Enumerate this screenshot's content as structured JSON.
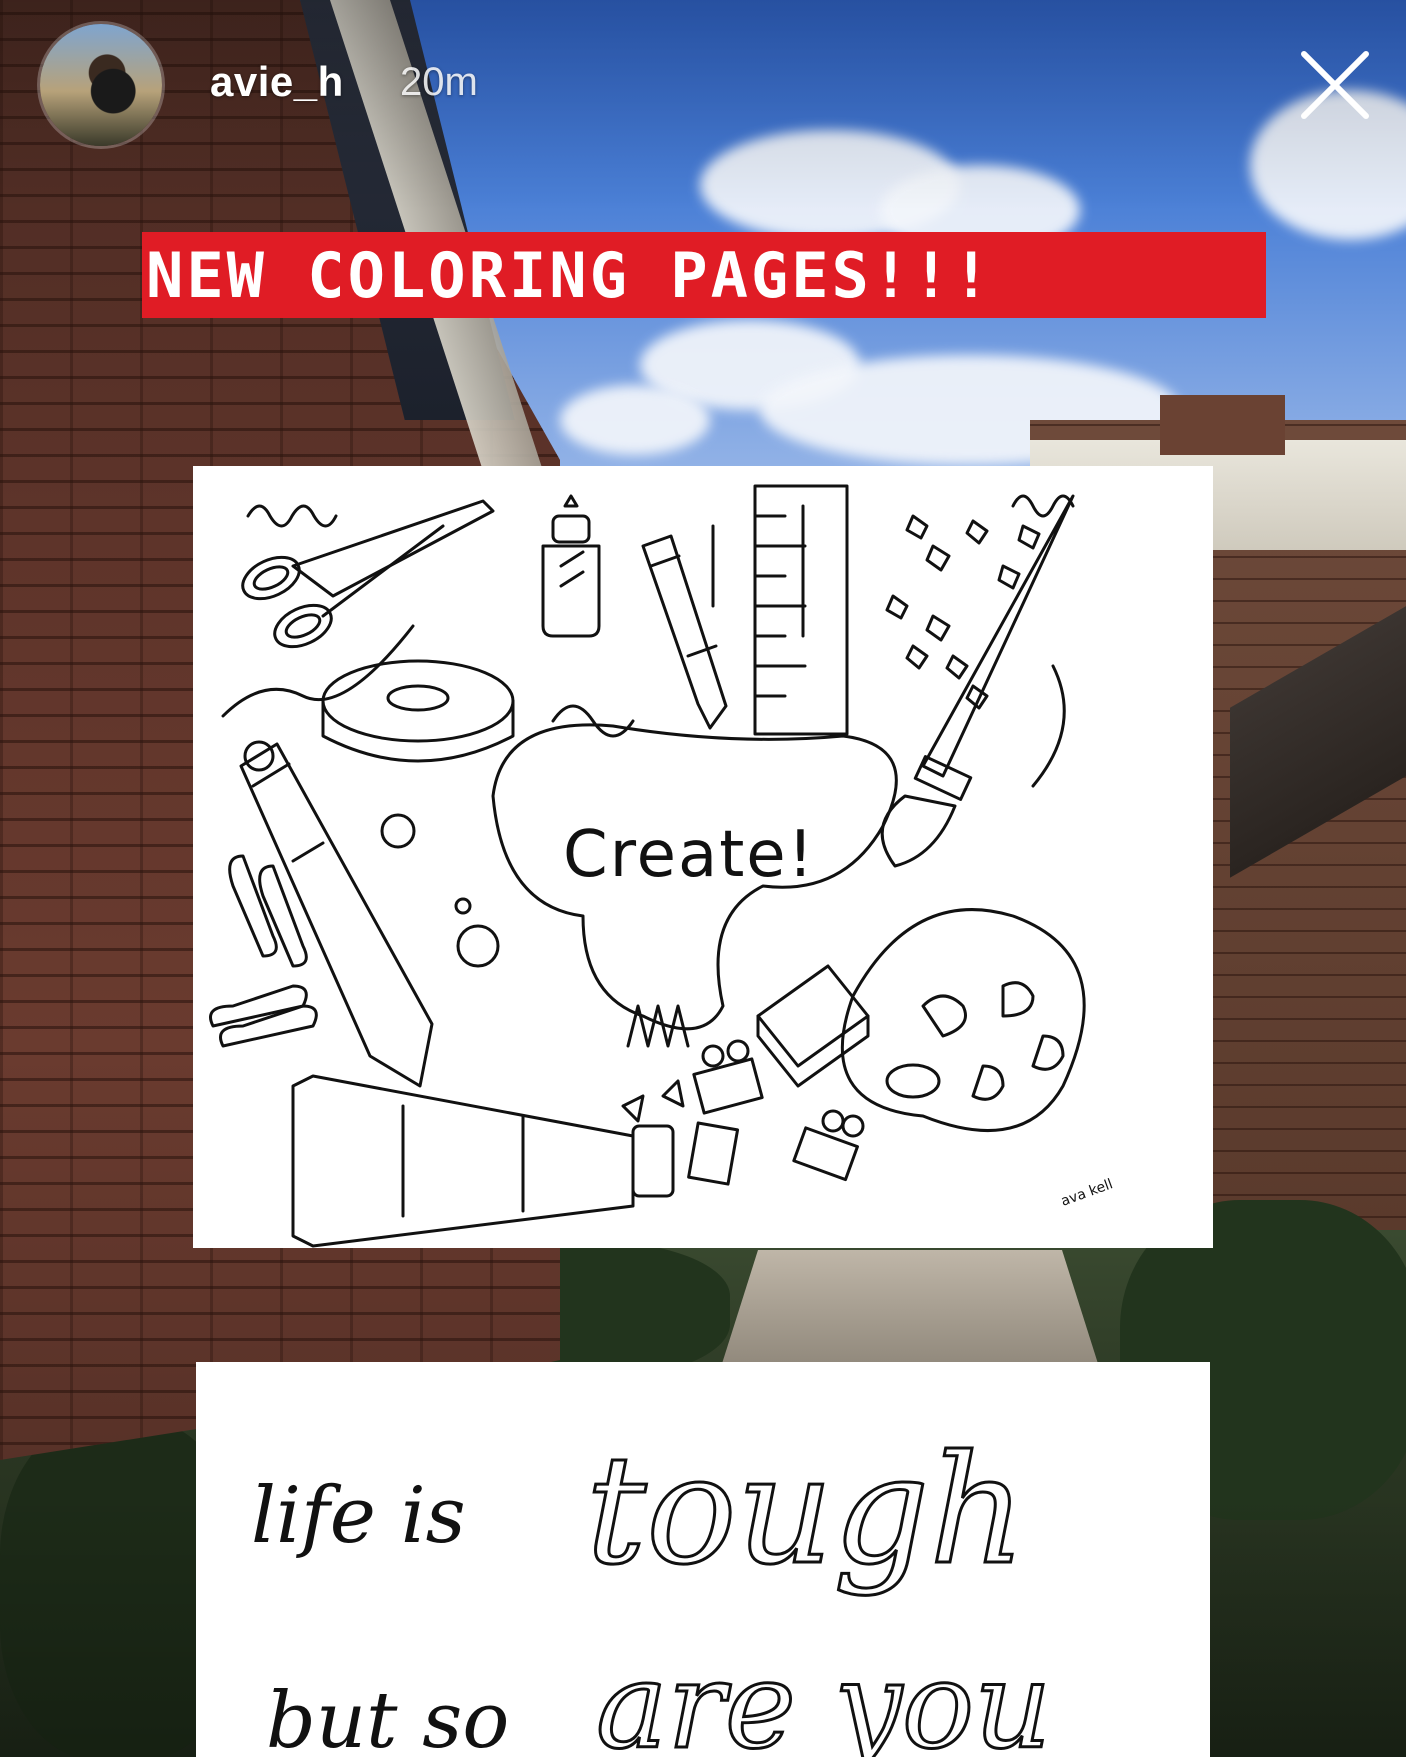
{
  "story": {
    "username": "avie_h",
    "time_ago": "20m"
  },
  "headline": "NEW COLORING PAGES!!!",
  "coloring_page_1": {
    "center_word": "Create!",
    "signature": "ava kell"
  },
  "coloring_page_2": {
    "line1_small": "life is",
    "line1_big": "tough",
    "line2_small": "but so",
    "line2_big": "are you"
  },
  "colors": {
    "headline_bg": "#e01c25",
    "headline_text": "#ffffff"
  },
  "icons": {
    "close": "close-icon"
  }
}
